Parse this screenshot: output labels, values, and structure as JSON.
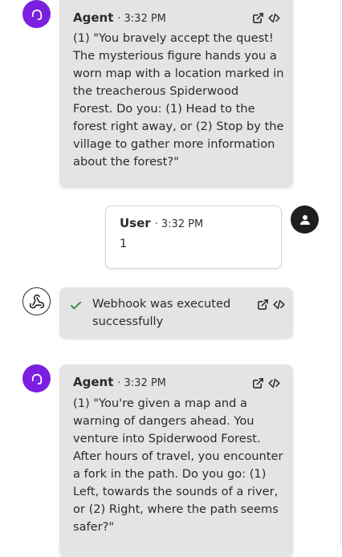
{
  "messages": [
    {
      "sender": "Agent",
      "time": "3:32 PM",
      "lines": [
        "(1) \"You bravely accept the quest!",
        "The mysterious figure hands you a",
        "worn map with a location marked in",
        "the treacherous Spiderwood",
        "Forest. Do you: (1) Head to the",
        "forest right away, or (2) Stop by the",
        "village to gather more information",
        "about the forest?\""
      ]
    },
    {
      "sender": "User",
      "time": "3:32 PM",
      "lines": [
        "1"
      ]
    },
    {
      "sender": "Webhook",
      "status_icon": "checkmark-icon",
      "lines": [
        "Webhook was executed",
        "successfully"
      ]
    },
    {
      "sender": "Agent",
      "time": "3:32 PM",
      "lines": [
        "(1) \"You're given a map and a",
        "warning of dangers ahead. You",
        "venture into Spiderwood Forest.",
        "After hours of travel, you encounter",
        "a fork in the path. Do you go: (1)",
        "Left, towards the sounds of a river,",
        "or (2) Right, where the path seems",
        "safer?\""
      ]
    }
  ],
  "separator": "·",
  "icons": {
    "agent_avatar": "headset-icon",
    "user_avatar": "person-icon",
    "webhook_avatar": "webhook-icon",
    "open": "external-link-icon",
    "code": "code-icon"
  },
  "colors": {
    "agent_avatar": "#7b1fe0",
    "user_avatar": "#1f1f1f",
    "agent_bubble": "#e4e4e4",
    "success_check": "#2e8b3d"
  }
}
